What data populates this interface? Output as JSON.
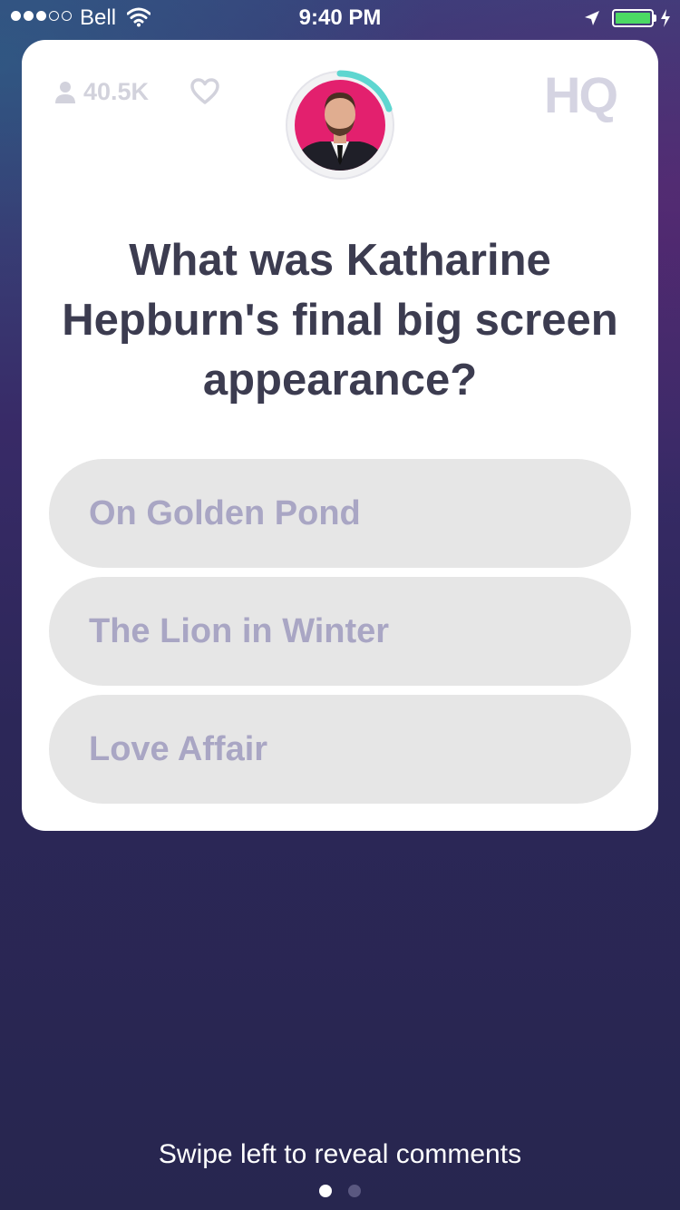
{
  "status_bar": {
    "carrier": "Bell",
    "time": "9:40 PM",
    "signal_bars_filled": 3,
    "signal_bars_total": 5,
    "battery_color": "#4cd964"
  },
  "game": {
    "viewer_count": "40.5K",
    "logo": "HQ",
    "question": "What was Katharine Hepburn's final big screen appearance?",
    "answers": [
      {
        "label": "On Golden Pond"
      },
      {
        "label": "The Lion in Winter"
      },
      {
        "label": "Love Affair"
      }
    ]
  },
  "footer": {
    "hint": "Swipe left to reveal comments",
    "pages": 2,
    "active_page": 1
  },
  "colors": {
    "timer_ring": "#5ed6d0",
    "question_text": "#3c3c50",
    "answer_text": "#a9a6c4",
    "answer_bg": "#e6e6e6"
  }
}
